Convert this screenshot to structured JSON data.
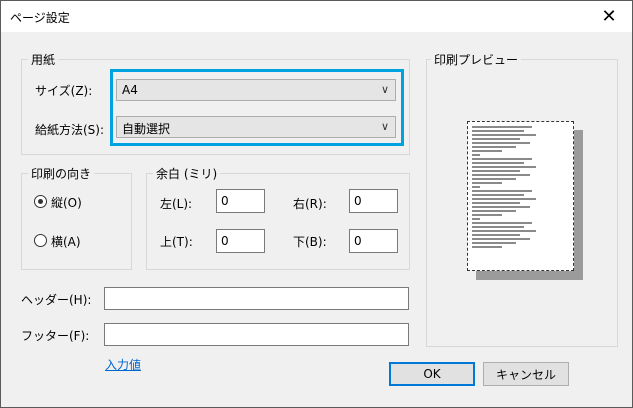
{
  "window": {
    "title": "ページ設定"
  },
  "paper_group": {
    "legend": "用紙",
    "size_label": "サイズ(Z):",
    "size_value": "A4",
    "source_label": "給紙方法(S):",
    "source_value": "自動選択"
  },
  "orientation_group": {
    "legend": "印刷の向き",
    "portrait_label": "縦(O)",
    "landscape_label": "横(A)",
    "selected": "portrait"
  },
  "margins_group": {
    "legend": "余白 (ミリ)",
    "left_label": "左(L):",
    "left_value": "0",
    "right_label": "右(R):",
    "right_value": "0",
    "top_label": "上(T):",
    "top_value": "0",
    "bottom_label": "下(B):",
    "bottom_value": "0"
  },
  "header": {
    "label": "ヘッダー(H):",
    "value": ""
  },
  "footer": {
    "label": "フッター(F):",
    "value": ""
  },
  "input_link": "入力値",
  "preview": {
    "legend": "印刷プレビュー"
  },
  "buttons": {
    "ok": "OK",
    "cancel": "キャンセル"
  },
  "colors": {
    "highlight": "#00a3e0",
    "ok_border": "#0078d7",
    "link": "#0066cc"
  }
}
